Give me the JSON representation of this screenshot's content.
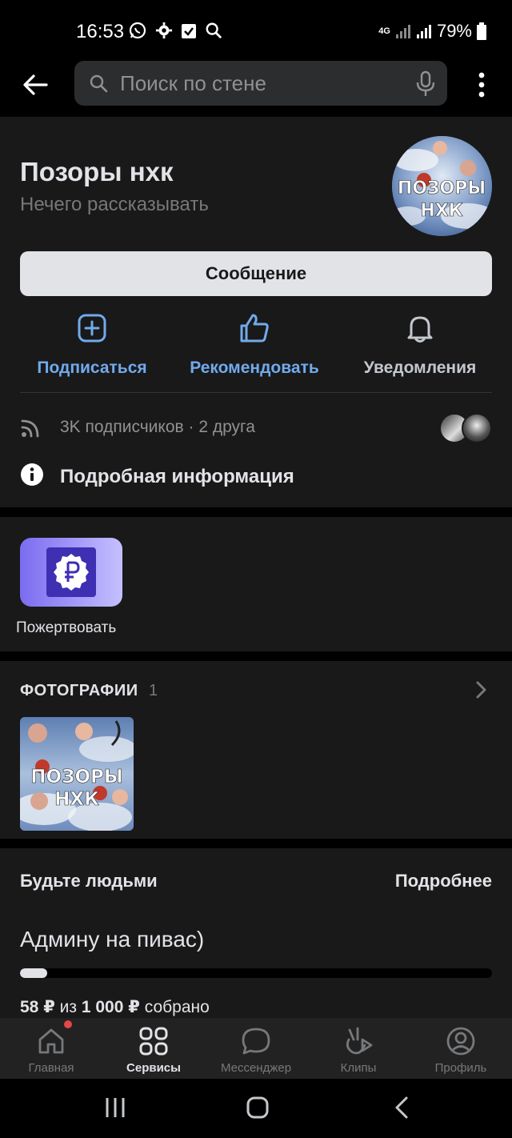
{
  "status_bar": {
    "time": "16:53",
    "network": "4G",
    "battery": "79%"
  },
  "search": {
    "placeholder": "Поиск по стене"
  },
  "group": {
    "title": "Позоры нхк",
    "status": "Нечего рассказывать",
    "avatar_text_line1": "ПОЗОРЫ",
    "avatar_text_line2": "НХК"
  },
  "buttons": {
    "message": "Сообщение"
  },
  "actions": [
    {
      "label": "Подписаться",
      "icon": "add-square-icon"
    },
    {
      "label": "Рекомендовать",
      "icon": "thumbs-up-icon"
    },
    {
      "label": "Уведомления",
      "icon": "bell-icon"
    }
  ],
  "followers": {
    "text": "3K подписчиков · 2 друга"
  },
  "info": {
    "label": "Подробная информация"
  },
  "donate": {
    "label": "Пожертвовать",
    "icon": "ruble-badge-icon"
  },
  "photos": {
    "heading": "ФОТОГРАФИИ",
    "count": "1",
    "photo_text_line1": "ПОЗОРЫ",
    "photo_text_line2": "НХК"
  },
  "goal": {
    "title": "Будьте людьми",
    "more": "Подробнее",
    "name": "Админу на пивас)",
    "collected": "58 ₽",
    "separator": "из",
    "target": "1 000 ₽",
    "suffix": "собрано",
    "progress_fraction": 0.058
  },
  "tabs": [
    {
      "label": "Главная",
      "icon": "home-icon",
      "active": false
    },
    {
      "label": "Сервисы",
      "icon": "services-grid-icon",
      "active": true
    },
    {
      "label": "Мессенджер",
      "icon": "chat-bubble-icon",
      "active": false
    },
    {
      "label": "Клипы",
      "icon": "clips-icon",
      "active": false
    },
    {
      "label": "Профиль",
      "icon": "profile-icon",
      "active": false
    }
  ],
  "colors": {
    "accent": "#71aaeb",
    "background": "#19191a",
    "notification_dot": "#e64646"
  }
}
